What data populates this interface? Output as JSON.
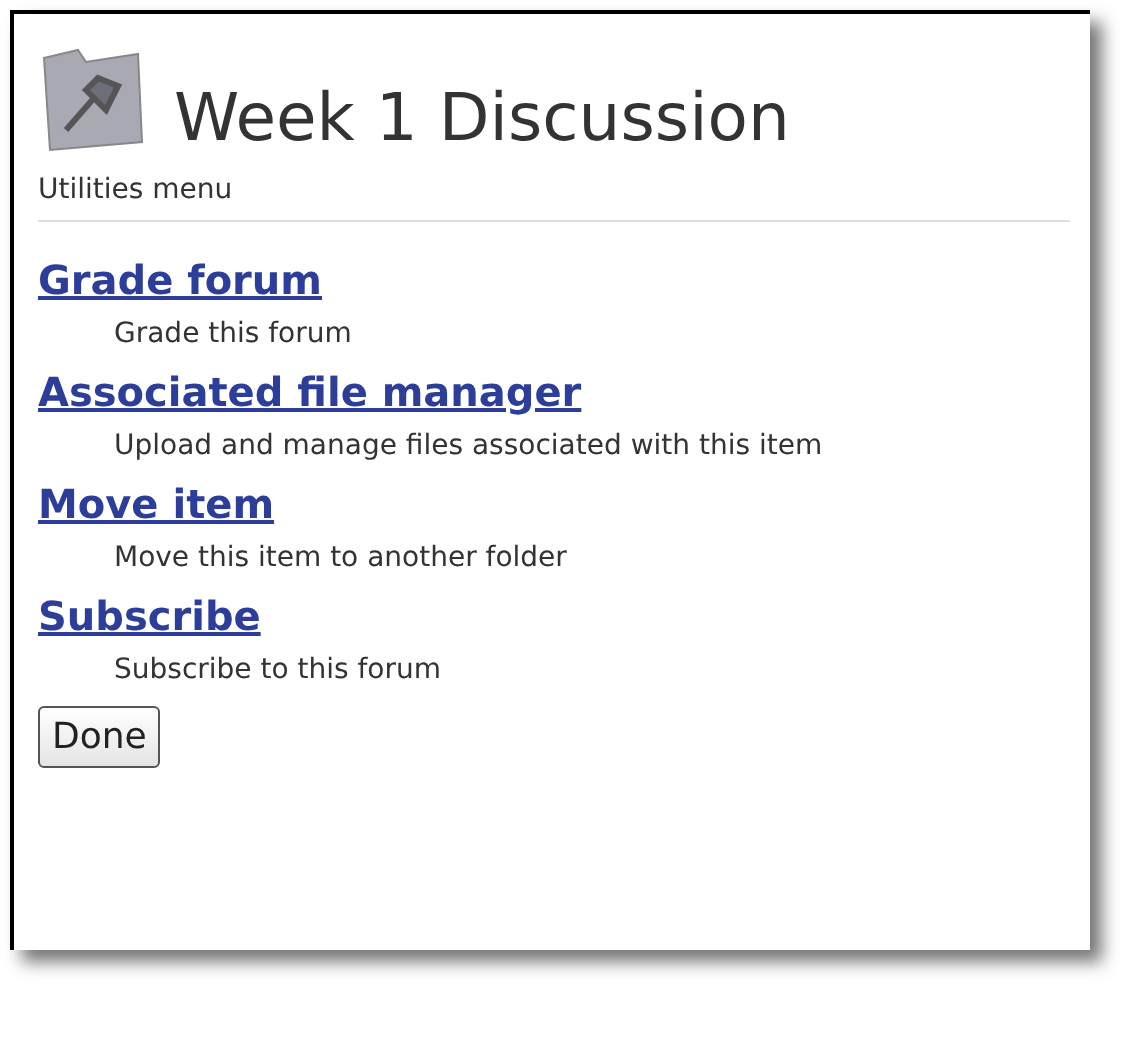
{
  "header": {
    "title": "Week 1 Discussion",
    "subtitle": "Utilities menu"
  },
  "menu_items": [
    {
      "label": "Grade forum",
      "description": "Grade this forum"
    },
    {
      "label": "Associated file manager",
      "description": "Upload and manage files associated with this item"
    },
    {
      "label": "Move item",
      "description": "Move this item to another folder"
    },
    {
      "label": "Subscribe",
      "description": "Subscribe to this forum"
    }
  ],
  "buttons": [
    "Done"
  ]
}
